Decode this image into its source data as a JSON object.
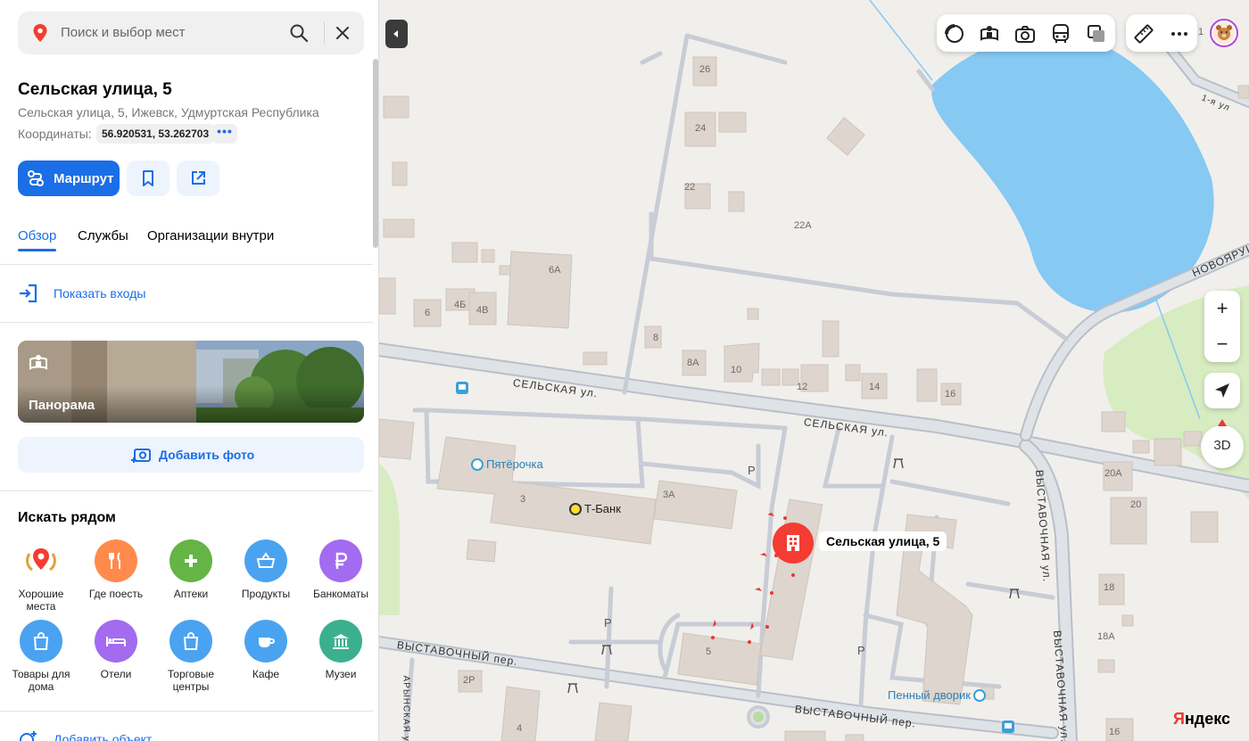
{
  "search": {
    "placeholder": "Поиск и выбор мест"
  },
  "place": {
    "title": "Сельская улица, 5",
    "subtitle": "Сельская улица, 5, Ижевск, Удмуртская Республика",
    "coords_label": "Координаты:",
    "coords_value": "56.920531, 53.262703",
    "coords_more": "•••"
  },
  "actions": {
    "route_label": "Маршрут"
  },
  "tabs": [
    {
      "label": "Обзор",
      "active": true
    },
    {
      "label": "Службы"
    },
    {
      "label": "Организации внутри"
    }
  ],
  "entrances_label": "Показать входы",
  "panorama_label": "Панорама",
  "add_photo_label": "Добавить фото",
  "nearby": {
    "title": "Искать рядом",
    "categories": [
      {
        "label": "Хорошие места",
        "icon": "good-places-icon",
        "color": "#ffffff"
      },
      {
        "label": "Где поесть",
        "icon": "fork-knife-icon",
        "color": "#ff8a4c"
      },
      {
        "label": "Аптеки",
        "icon": "pharmacy-cross-icon",
        "color": "#64b446"
      },
      {
        "label": "Продукты",
        "icon": "basket-icon",
        "color": "#4aa3f0"
      },
      {
        "label": "Банкоматы",
        "icon": "ruble-icon",
        "color": "#a26bf0"
      },
      {
        "label": "Товары для дома",
        "icon": "shopping-bag-icon",
        "color": "#4aa3f0"
      },
      {
        "label": "Отели",
        "icon": "bed-icon",
        "color": "#a26bf0"
      },
      {
        "label": "Торговые центры",
        "icon": "shopping-bag-icon",
        "color": "#4aa3f0"
      },
      {
        "label": "Кафе",
        "icon": "cup-icon",
        "color": "#4aa3f0"
      },
      {
        "label": "Музеи",
        "icon": "museum-icon",
        "color": "#3bb08f"
      }
    ]
  },
  "add_object_label": "Добавить объект",
  "map": {
    "street_labels": [
      "СЕЛЬСКАЯ ул.",
      "СЕЛЬСКАЯ ул.",
      "ВЫСТАВОЧНЫЙ пер.",
      "ВЫСТАВОЧНЫЙ пер.",
      "ВЫСТАВОЧНАЯ ул.",
      "ВЫСТАВОЧНАЯ ул.",
      "НОВОЯРУШ",
      "1-я ул",
      "АРЫНСКАЯ ул."
    ],
    "house_numbers": [
      "26",
      "24",
      "22",
      "22А",
      "6А",
      "4Б",
      "4В",
      "6",
      "8",
      "8А",
      "10",
      "12",
      "14",
      "16",
      "3",
      "3А",
      "5",
      "2Р",
      "4",
      "20А",
      "20",
      "18",
      "18А",
      "16",
      "1"
    ],
    "parking_label": "P",
    "pois": [
      {
        "name": "Пятёрочка",
        "color": "#3aa0d6"
      },
      {
        "name": "Т-Банк",
        "color": "#ffdd2d"
      },
      {
        "name": "Пенный дворик",
        "color": "#3aa0d6"
      }
    ],
    "selected_label": "Сельская улица, 5",
    "zoom_in": "+",
    "zoom_out": "−",
    "btn_3d": "3D",
    "logo_y": "Я",
    "logo_rest": "ндекс"
  }
}
